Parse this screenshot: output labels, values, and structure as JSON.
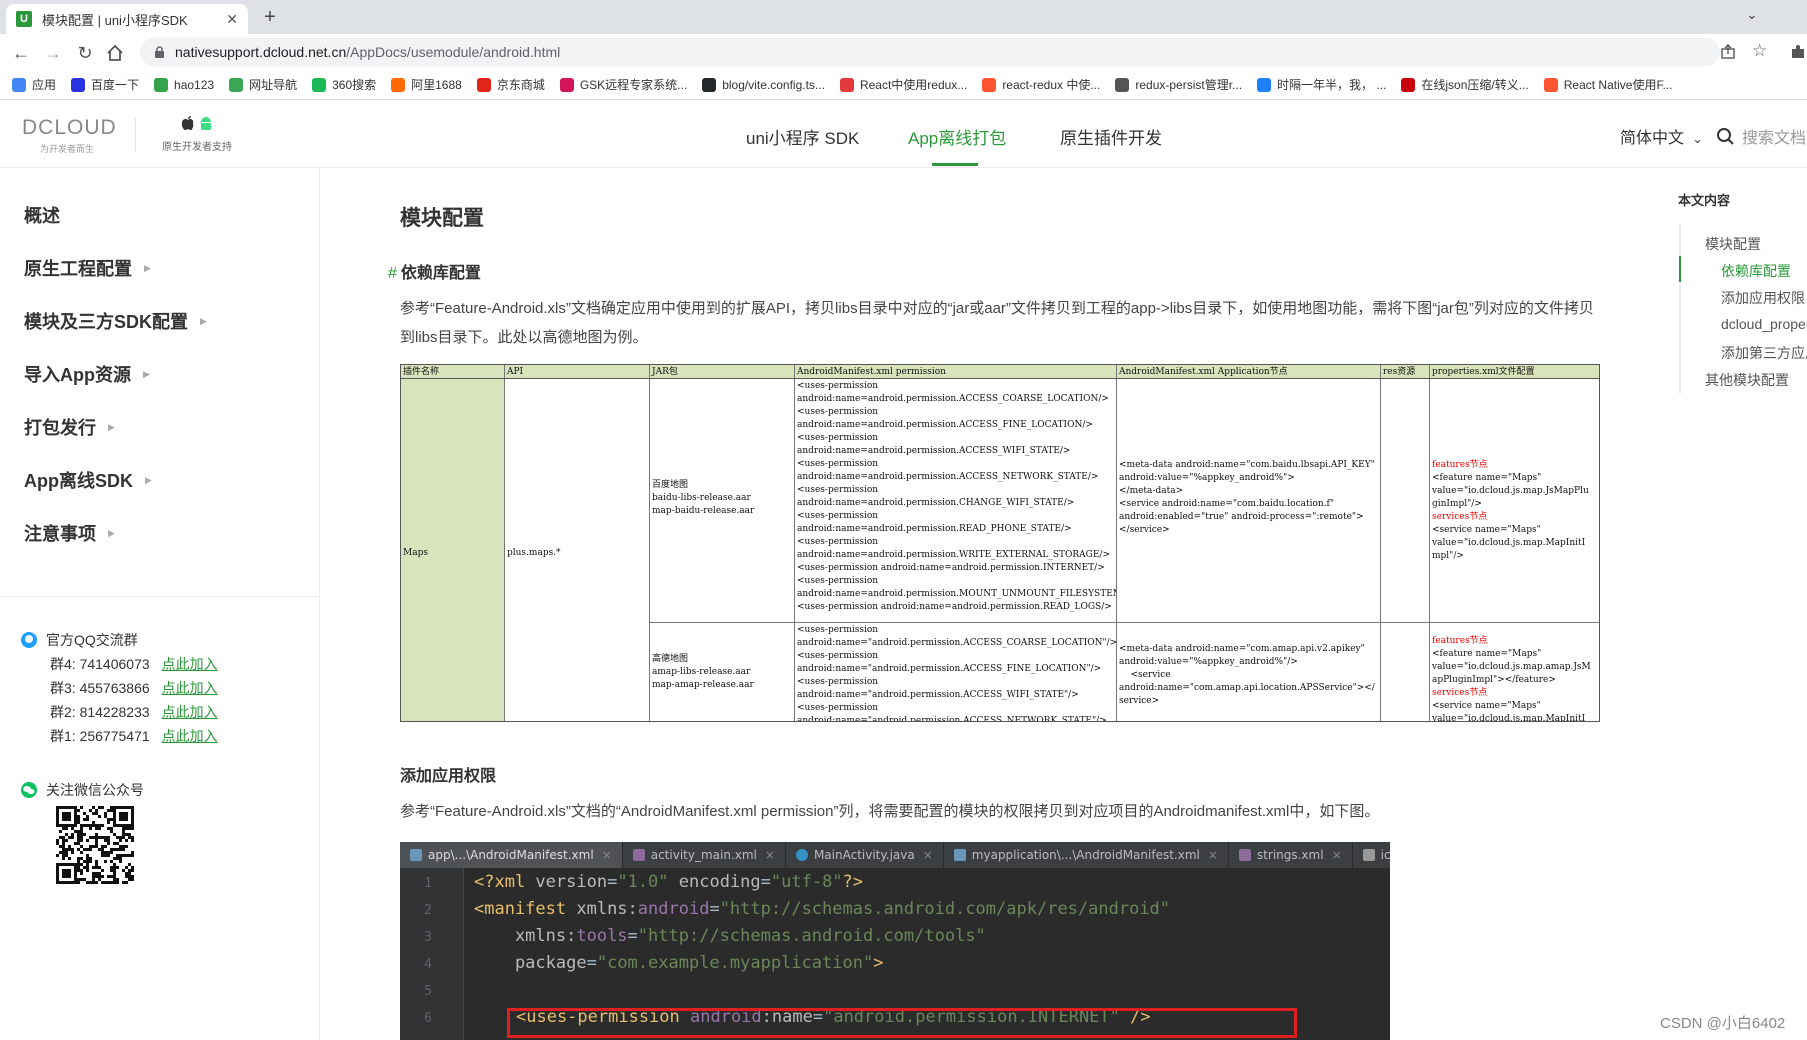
{
  "browser": {
    "tab_title": "模块配置 | uni小程序SDK",
    "tab_favicon_letter": "U",
    "new_tab": "+",
    "url_host": "nativesupport.dcloud.net.cn",
    "url_path": "/AppDocs/usemodule/android.html",
    "bookmarks": [
      {
        "label": "应用",
        "color": "#4285f4"
      },
      {
        "label": "百度一下",
        "color": "#2932e1"
      },
      {
        "label": "hao123",
        "color": "#35a34a"
      },
      {
        "label": "网址导航",
        "color": "#3aa757"
      },
      {
        "label": "360搜索",
        "color": "#19b955"
      },
      {
        "label": "阿里1688",
        "color": "#ff6a00"
      },
      {
        "label": "京东商城",
        "color": "#e1251b"
      },
      {
        "label": "GSK远程专家系统...",
        "color": "#d4145a"
      },
      {
        "label": "blog/vite.config.ts...",
        "color": "#24292e"
      },
      {
        "label": "React中使用redux...",
        "color": "#e4393c"
      },
      {
        "label": "react-redux 中使...",
        "color": "#fc5531"
      },
      {
        "label": "redux-persist管理r...",
        "color": "#555555"
      },
      {
        "label": "时隔一年半，我， ...",
        "color": "#1e80ff"
      },
      {
        "label": "在线json压缩/转义...",
        "color": "#c7000b"
      },
      {
        "label": "React Native使用F...",
        "color": "#fc5531"
      }
    ]
  },
  "header": {
    "logo_text": "DCLOUD",
    "logo_slogan": "为开发者而生",
    "native_badge": "原生开发者支持",
    "nav": [
      "uni小程序 SDK",
      "App离线打包",
      "原生插件开发"
    ],
    "lang": "简体中文",
    "search_placeholder": "搜索文档",
    "accent_color": "#2b9939"
  },
  "sidebar": {
    "items": [
      "概述",
      "原生工程配置",
      "模块及三方SDK配置",
      "导入App资源",
      "打包发行",
      "App离线SDK",
      "注意事项"
    ],
    "qq_title": "官方QQ交流群",
    "qq_groups": [
      {
        "name": "群4:",
        "number": "741406073",
        "link": "点此加入"
      },
      {
        "name": "群3:",
        "number": "455763866",
        "link": "点此加入"
      },
      {
        "name": "群2:",
        "number": "814228233",
        "link": "点此加入"
      },
      {
        "name": "群1:",
        "number": "256775471",
        "link": "点此加入"
      }
    ],
    "wechat_title": "关注微信公众号"
  },
  "article": {
    "title": "模块配置",
    "h3_dependency": "依赖库配置",
    "hash": "#",
    "para1": "参考“Feature-Android.xls”文档确定应用中使用到的扩展API，拷贝libs目录中对应的“jar或aar”文件拷贝到工程的app->libs目录下，如使用地图功能，需将下图“jar包”列对应的文件拷贝到libs目录下。此处以高德地图为例。",
    "h3_permission": "添加应用权限",
    "para2": "参考“Feature-Android.xls”文档的“AndroidManifest.xml permission”列，将需要配置的模块的权限拷贝到对应项目的Androidmanifest.xml中，如下图。"
  },
  "sheet": {
    "headers": [
      "插件名称",
      "API",
      "JAR包",
      "AndroidManifest.xml permission",
      "AndroidManifest.xml Application节点",
      "res资源",
      "properties.xml文件配置"
    ],
    "plugin": "Maps",
    "api": "plus.maps.*",
    "baidu_jar": "百度地图\nbaidu-libs-release.aar\nmap-baidu-release.aar",
    "baidu_perm": "<uses-permission\nandroid:name=android.permission.ACCESS_COARSE_LOCATION/>\n<uses-permission\nandroid:name=android.permission.ACCESS_FINE_LOCATION/>\n<uses-permission\nandroid:name=android.permission.ACCESS_WIFI_STATE/>\n<uses-permission\nandroid:name=android.permission.ACCESS_NETWORK_STATE/>\n<uses-permission\nandroid:name=android.permission.CHANGE_WIFI_STATE/>\n<uses-permission\nandroid:name=android.permission.READ_PHONE_STATE/>\n<uses-permission\nandroid:name=android.permission.WRITE_EXTERNAL_STORAGE/>\n<uses-permission android:name=android.permission.INTERNET/>\n<uses-permission\nandroid:name=android.permission.MOUNT_UNMOUNT_FILESYSTEMS/>\n<uses-permission android:name=android.permission.READ_LOGS/>",
    "baidu_app": "<meta-data android:name=\"com.baidu.lbsapi.API_KEY\"\nandroid:value=\"%appkey_android%\">\n</meta-data>\n<service android:name=\"com.baidu.location.f\"\nandroid:enabled=\"true\" android:process=\":remote\">\n</service>",
    "baidu_props_red1": "features节点",
    "baidu_props1": "<feature name=\"Maps\"\nvalue=\"io.dcloud.js.map.JsMapPlu\nginImpl\"/>",
    "baidu_props_red2": "services节点",
    "baidu_props2": "<service name=\"Maps\"\nvalue=\"io.dcloud.js.map.MapInitI\nmpl\"/>",
    "amap_jar": "高德地图\namap-libs-release.aar\nmap-amap-release.aar",
    "amap_perm": "<uses-permission\nandroid:name=\"android.permission.ACCESS_COARSE_LOCATION\"/>\n<uses-permission\nandroid:name=\"android.permission.ACCESS_FINE_LOCATION\"/>\n<uses-permission\nandroid:name=\"android.permission.ACCESS_WIFI_STATE\"/>\n<uses-permission\nandroid:name=\"android.permission.ACCESS_NETWORK_STATE\"/>",
    "amap_app": "<meta-data android:name=\"com.amap.api.v2.apikey\"\nandroid:value=\"%appkey_android%\"/>\n    <service\nandroid:name=\"com.amap.api.location.APSService\"></\nservice>",
    "amap_props_red1": "features节点",
    "amap_props1": "<feature name=\"Maps\"\nvalue=\"io.dcloud.js.map.amap.JsM\napPluginImpl\"></feature>",
    "amap_props_red2": "services节点",
    "amap_props2": "<service name=\"Maps\"\nvalue=\"io.dcloud.js.map.MapInitI"
  },
  "editor": {
    "tabs": [
      "app\\...\\AndroidManifest.xml",
      "activity_main.xml",
      "MainActivity.java",
      "myapplication\\...\\AndroidManifest.xml",
      "strings.xml",
      "icon.png"
    ],
    "tab_close": "×",
    "line_numbers": [
      "1",
      "2",
      "3",
      "4",
      "5",
      "6"
    ],
    "l1_a": "<?xml ",
    "l1_b": "version",
    "l1_c": "=",
    "l1_d": "\"1.0\"",
    "l1_e": " encoding",
    "l1_f": "=",
    "l1_g": "\"utf-8\"",
    "l1_h": "?>",
    "l2_a": "<manifest ",
    "l2_b": "xmlns:",
    "l2_c": "android",
    "l2_d": "=",
    "l2_e": "\"http://schemas.android.com/apk/res/android\"",
    "l3_a": "    xmlns:",
    "l3_b": "tools",
    "l3_c": "=",
    "l3_d": "\"http://schemas.android.com/tools\"",
    "l4_a": "    package",
    "l4_b": "=",
    "l4_c": "\"com.example.myapplication\"",
    "l4_d": ">",
    "l6_a": "<uses-permission ",
    "l6_b": "android",
    "l6_c": ":name",
    "l6_d": "=",
    "l6_e": "\"android.permission.INTERNET\"",
    "l6_f": " />"
  },
  "toc": {
    "heading": "本文内容",
    "items": [
      "模块配置",
      "依赖库配置",
      "添加应用权限",
      "dcloud_properties",
      "添加第三方应用",
      "其他模块配置"
    ]
  },
  "watermark": "CSDN @小白6402"
}
